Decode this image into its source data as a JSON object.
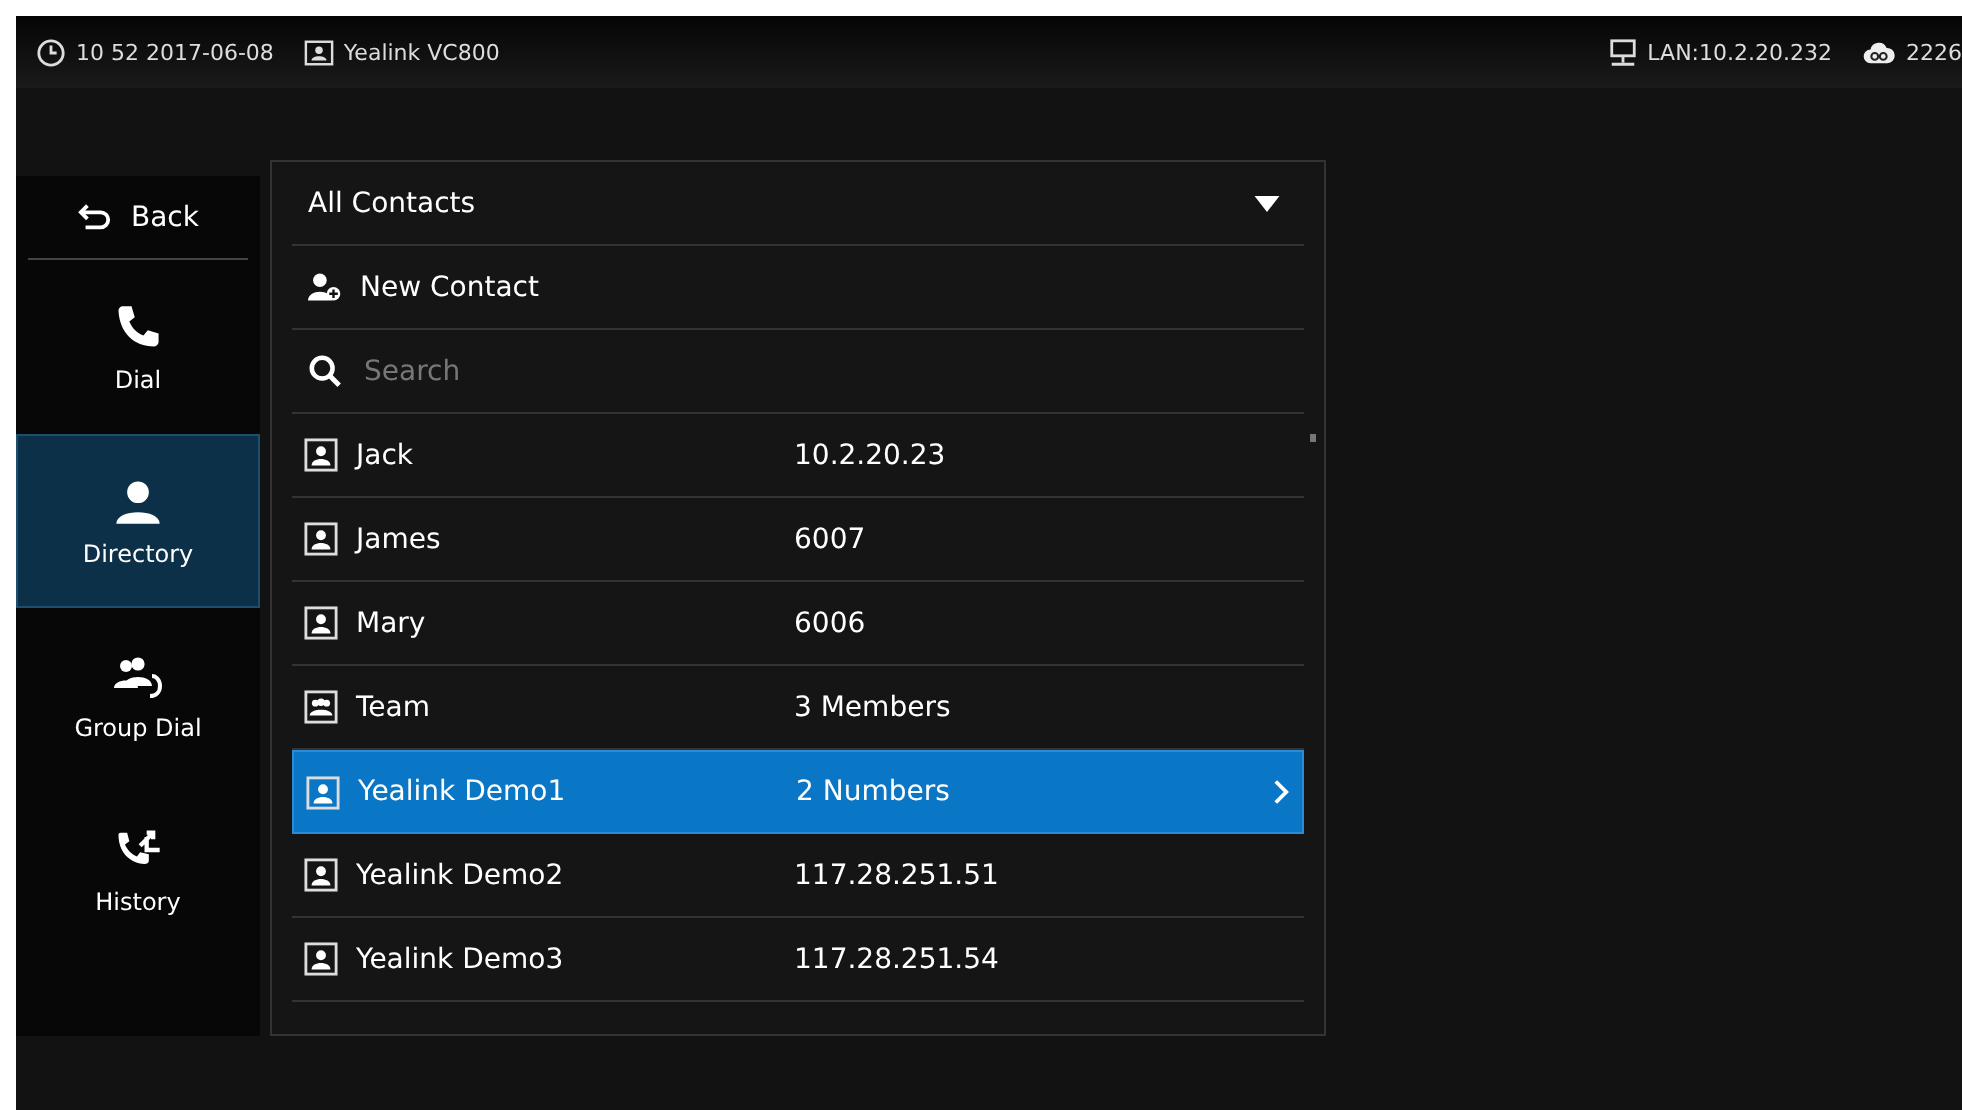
{
  "status_bar": {
    "time": "10 52 2017-06-08",
    "device": "Yealink VC800",
    "network": "LAN:10.2.20.232",
    "account": "2226"
  },
  "sidebar": {
    "back": "Back",
    "items": [
      {
        "label": "Dial",
        "kind": "dial",
        "selected": false
      },
      {
        "label": "Directory",
        "kind": "directory",
        "selected": true
      },
      {
        "label": "Group Dial",
        "kind": "group",
        "selected": false
      },
      {
        "label": "History",
        "kind": "history",
        "selected": false
      }
    ]
  },
  "directory": {
    "group_select": "All Contacts",
    "new_contact": "New Contact",
    "search": {
      "placeholder": "Search"
    },
    "contacts": [
      {
        "name": "Jack",
        "detail": "10.2.20.23",
        "kind": "person",
        "selected": false
      },
      {
        "name": "James",
        "detail": "6007",
        "kind": "person",
        "selected": false
      },
      {
        "name": "Mary",
        "detail": "6006",
        "kind": "person",
        "selected": false
      },
      {
        "name": "Team",
        "detail": "3 Members",
        "kind": "group",
        "selected": false
      },
      {
        "name": "Yealink Demo1",
        "detail": "2 Numbers",
        "kind": "person",
        "selected": true
      },
      {
        "name": "Yealink Demo2",
        "detail": "117.28.251.51",
        "kind": "person",
        "selected": false
      },
      {
        "name": "Yealink Demo3",
        "detail": "117.28.251.54",
        "kind": "person",
        "selected": false
      }
    ]
  }
}
